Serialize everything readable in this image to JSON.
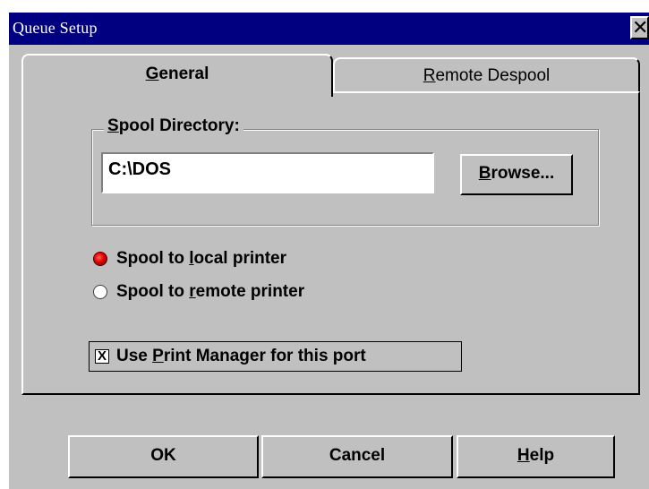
{
  "window": {
    "title": "Queue Setup",
    "close_glyph": "✕"
  },
  "tabs": [
    {
      "label": "General",
      "mnemonic": "G",
      "rest": "eneral",
      "active": true
    },
    {
      "label": "Remote Despool",
      "mnemonic": "R",
      "rest": "emote Despool",
      "active": false
    }
  ],
  "spool_directory": {
    "label_mnemonic": "S",
    "label_rest": "pool Directory:",
    "value": "C:\\DOS",
    "browse_mnemonic": "B",
    "browse_rest": "rowse..."
  },
  "radios": [
    {
      "before": "Spool to ",
      "mnemonic": "l",
      "after": "ocal printer",
      "checked": true
    },
    {
      "before": "Spool to ",
      "mnemonic": "r",
      "after": "emote printer",
      "checked": false
    }
  ],
  "checkbox": {
    "before": "Use ",
    "mnemonic": "P",
    "after": "rint Manager for this port",
    "checked": true,
    "mark": "X"
  },
  "buttons": {
    "ok": "OK",
    "cancel": "Cancel",
    "help_mnemonic": "H",
    "help_rest": "elp"
  }
}
